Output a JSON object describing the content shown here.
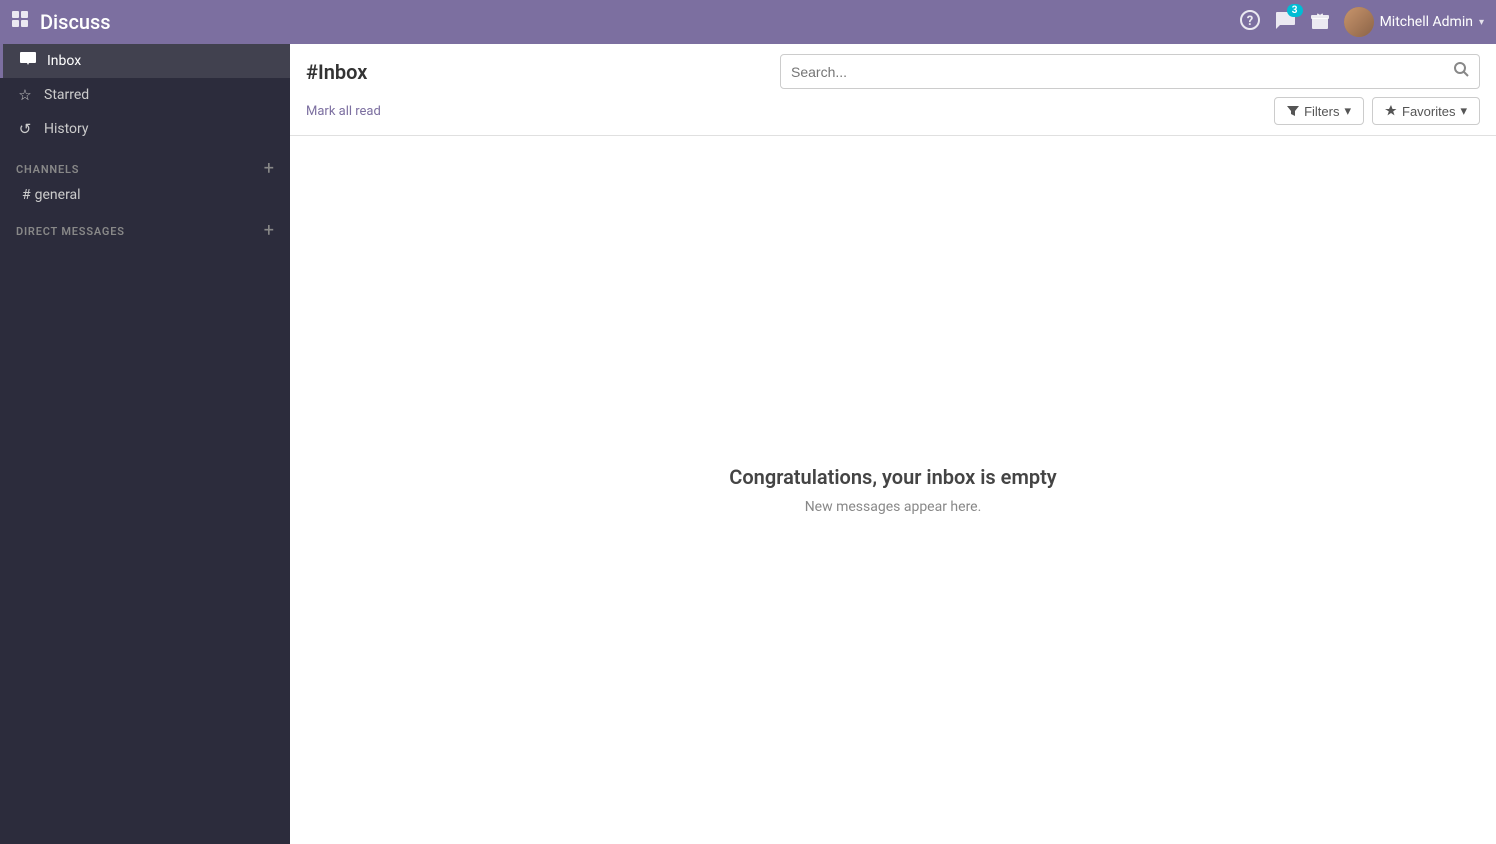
{
  "navbar": {
    "title": "Discuss",
    "grid_icon": "⊞",
    "actions": {
      "help_icon": "?",
      "messages_icon": "💬",
      "messages_badge": "3",
      "gift_icon": "🎁",
      "user_name": "Mitchell Admin",
      "caret": "▾"
    }
  },
  "sidebar": {
    "nav_items": [
      {
        "id": "inbox",
        "label": "Inbox",
        "icon": "✉",
        "active": true
      },
      {
        "id": "starred",
        "label": "Starred",
        "icon": "☆",
        "active": false
      },
      {
        "id": "history",
        "label": "History",
        "icon": "↺",
        "active": false
      }
    ],
    "channels_section": {
      "label": "CHANNELS",
      "add_label": "+",
      "items": [
        {
          "id": "general",
          "label": "# general"
        }
      ]
    },
    "direct_messages_section": {
      "label": "DIRECT MESSAGES",
      "add_label": "+"
    }
  },
  "content": {
    "title": "#Inbox",
    "mark_all_read": "Mark all read",
    "search_placeholder": "Search...",
    "filters_label": "Filters",
    "favorites_label": "Favorites",
    "empty_state_title": "Congratulations, your inbox is empty",
    "empty_state_subtitle": "New messages appear here."
  }
}
